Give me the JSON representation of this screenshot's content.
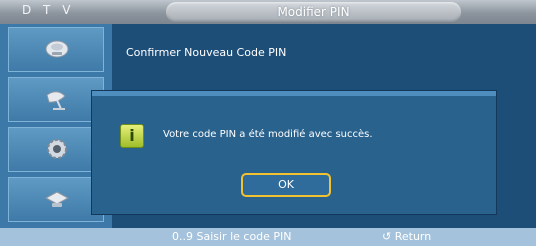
{
  "header": {
    "source": "D T V",
    "title": "Modifier PIN"
  },
  "sidebar": {
    "items": [
      {
        "icon": "picture-icon"
      },
      {
        "icon": "satellite-dish-icon"
      },
      {
        "icon": "settings-gear-icon"
      },
      {
        "icon": "input-icon"
      }
    ]
  },
  "main": {
    "heading": "Confirmer Nouveau Code PIN"
  },
  "dialog": {
    "icon": "info-icon",
    "icon_glyph": "i",
    "message": "Votre code PIN a été modifié avec succès.",
    "ok_label": "OK"
  },
  "footer": {
    "pin_hint": "0..9 Saisir le code PIN",
    "return_hint": "Return",
    "return_icon": "return-icon"
  },
  "colors": {
    "background": "#1d4e78",
    "sidebar": "#3c78a8",
    "accent": "#f2c230",
    "footer": "#a4c2dc"
  }
}
